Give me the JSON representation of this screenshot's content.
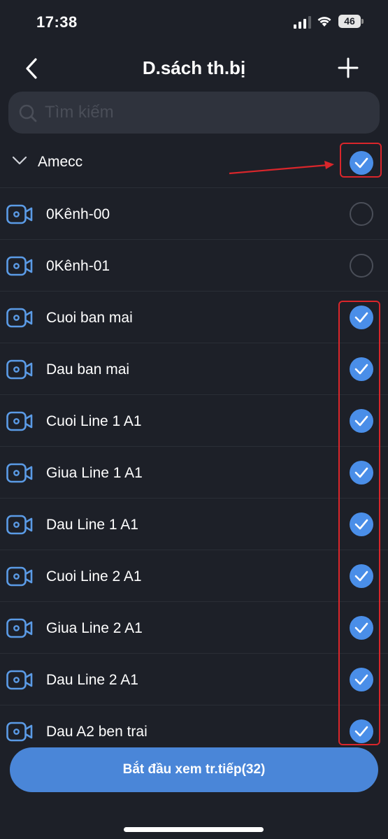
{
  "status": {
    "time": "17:38",
    "battery": "46",
    "icons": [
      "signal-icon",
      "wifi-icon",
      "battery-icon"
    ]
  },
  "nav": {
    "title": "D.sách th.bị",
    "back_icon": "chevron-left-icon",
    "add_icon": "plus-icon"
  },
  "search": {
    "placeholder": "Tìm kiếm",
    "value": ""
  },
  "group": {
    "name": "Amecc",
    "checked": true
  },
  "devices": [
    {
      "name": "0Kênh-00",
      "checked": false
    },
    {
      "name": "0Kênh-01",
      "checked": false
    },
    {
      "name": "Cuoi ban mai",
      "checked": true
    },
    {
      "name": "Dau ban mai",
      "checked": true
    },
    {
      "name": "Cuoi Line 1 A1",
      "checked": true
    },
    {
      "name": "Giua Line 1 A1",
      "checked": true
    },
    {
      "name": "Dau Line 1 A1",
      "checked": true
    },
    {
      "name": "Cuoi Line 2 A1",
      "checked": true
    },
    {
      "name": "Giua Line 2 A1",
      "checked": true
    },
    {
      "name": "Dau Line 2 A1",
      "checked": true
    },
    {
      "name": "Dau A2 ben trai",
      "checked": true
    }
  ],
  "start_button": {
    "label": "Bắt đầu xem tr.tiếp(32)"
  },
  "colors": {
    "background": "#1d2028",
    "accent": "#4a8ee8",
    "button": "#4a86d8",
    "camera_icon": "#5b9be6",
    "annotation": "#d9262b"
  }
}
